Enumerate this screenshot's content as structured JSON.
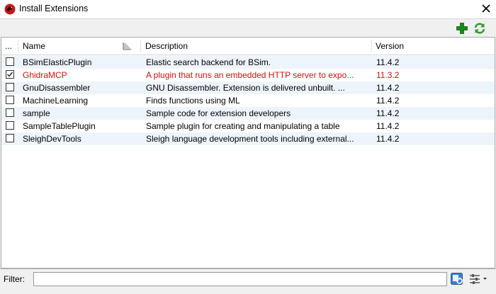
{
  "window": {
    "title": "Install Extensions",
    "app_icon": "ghidra-dragon-icon",
    "close_icon": "close-x-icon"
  },
  "toolbar": {
    "add_icon": "add-plus-icon",
    "refresh_icon": "refresh-icon",
    "colors": {
      "add": "#1c8a1c",
      "refresh": "#2e9a2e"
    }
  },
  "table": {
    "columns": {
      "checkbox": "...",
      "name": "Name",
      "description": "Description",
      "version": "Version"
    },
    "rows": [
      {
        "checked": false,
        "name": "BSimElasticPlugin",
        "description": "Elastic search backend for BSim.",
        "version": "11.4.2",
        "highlight": false
      },
      {
        "checked": true,
        "name": "GhidraMCP",
        "description": "A plugin that runs an embedded HTTP server to expo...",
        "version": "11.3.2",
        "highlight": true
      },
      {
        "checked": false,
        "name": "GnuDisassembler",
        "description": "GNU Disassembler.  Extension is delivered unbuilt.  ...",
        "version": "11.4.2",
        "highlight": false
      },
      {
        "checked": false,
        "name": "MachineLearning",
        "description": "Finds functions using ML",
        "version": "11.4.2",
        "highlight": false
      },
      {
        "checked": false,
        "name": "sample",
        "description": "Sample code for extension developers",
        "version": "11.4.2",
        "highlight": false
      },
      {
        "checked": false,
        "name": "SampleTablePlugin",
        "description": "Sample plugin for creating and manipulating a table",
        "version": "11.4.2",
        "highlight": false
      },
      {
        "checked": false,
        "name": "SleighDevTools",
        "description": "Sleigh language development tools including external...",
        "version": "11.4.2",
        "highlight": false
      }
    ],
    "colors": {
      "highlight_text": "#d01010",
      "alt_row": "#eef4fb"
    }
  },
  "filter": {
    "label": "Filter:",
    "value": "",
    "placeholder": "",
    "clear_icon": "filter-refresh-icon",
    "options_icon": "filter-options-icon"
  }
}
